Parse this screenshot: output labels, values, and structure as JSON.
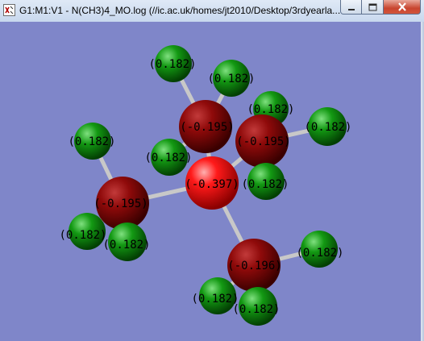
{
  "window": {
    "title": "G1:M1:V1 - N(CH3)4_MO.log (//ic.ac.uk/homes/jt2010/Desktop/3rdyearla..."
  },
  "viewport": {
    "background": "#7f86c9"
  },
  "atoms": {
    "nitrogen": {
      "label": "(-0.397)",
      "element": "N",
      "color": "#e00000"
    },
    "carbons": [
      {
        "label": "(-0.195)",
        "element": "C",
        "color": "#8b0000"
      },
      {
        "label": "(-0.195)",
        "element": "C",
        "color": "#8b0000"
      },
      {
        "label": "(-0.195)",
        "element": "C",
        "color": "#8b0000"
      },
      {
        "label": "(-0.196)",
        "element": "C",
        "color": "#8b0000"
      }
    ],
    "hydrogens": [
      {
        "label": "(0.182)",
        "element": "H",
        "color": "#0a8a0a"
      },
      {
        "label": "(0.182)",
        "element": "H",
        "color": "#0a8a0a"
      },
      {
        "label": "(0.182)",
        "element": "H",
        "color": "#0a8a0a"
      },
      {
        "label": "(0.182)",
        "element": "H",
        "color": "#0a8a0a"
      },
      {
        "label": "(0.182)",
        "element": "H",
        "color": "#0a8a0a"
      },
      {
        "label": "(0.182)",
        "element": "H",
        "color": "#0a8a0a"
      },
      {
        "label": "(0.182)",
        "element": "H",
        "color": "#0a8a0a"
      },
      {
        "label": "(0.182)",
        "element": "H",
        "color": "#0a8a0a"
      },
      {
        "label": "(0.182)",
        "element": "H",
        "color": "#0a8a0a"
      },
      {
        "label": "(0.182)",
        "element": "H",
        "color": "#0a8a0a"
      },
      {
        "label": "(0.182)",
        "element": "H",
        "color": "#0a8a0a"
      },
      {
        "label": "(0.182)",
        "element": "H",
        "color": "#0a8a0a"
      }
    ]
  },
  "icons": {
    "app": "gaussview-document-icon",
    "minimize": "minimize-icon",
    "maximize": "maximize-icon",
    "close": "close-icon"
  }
}
